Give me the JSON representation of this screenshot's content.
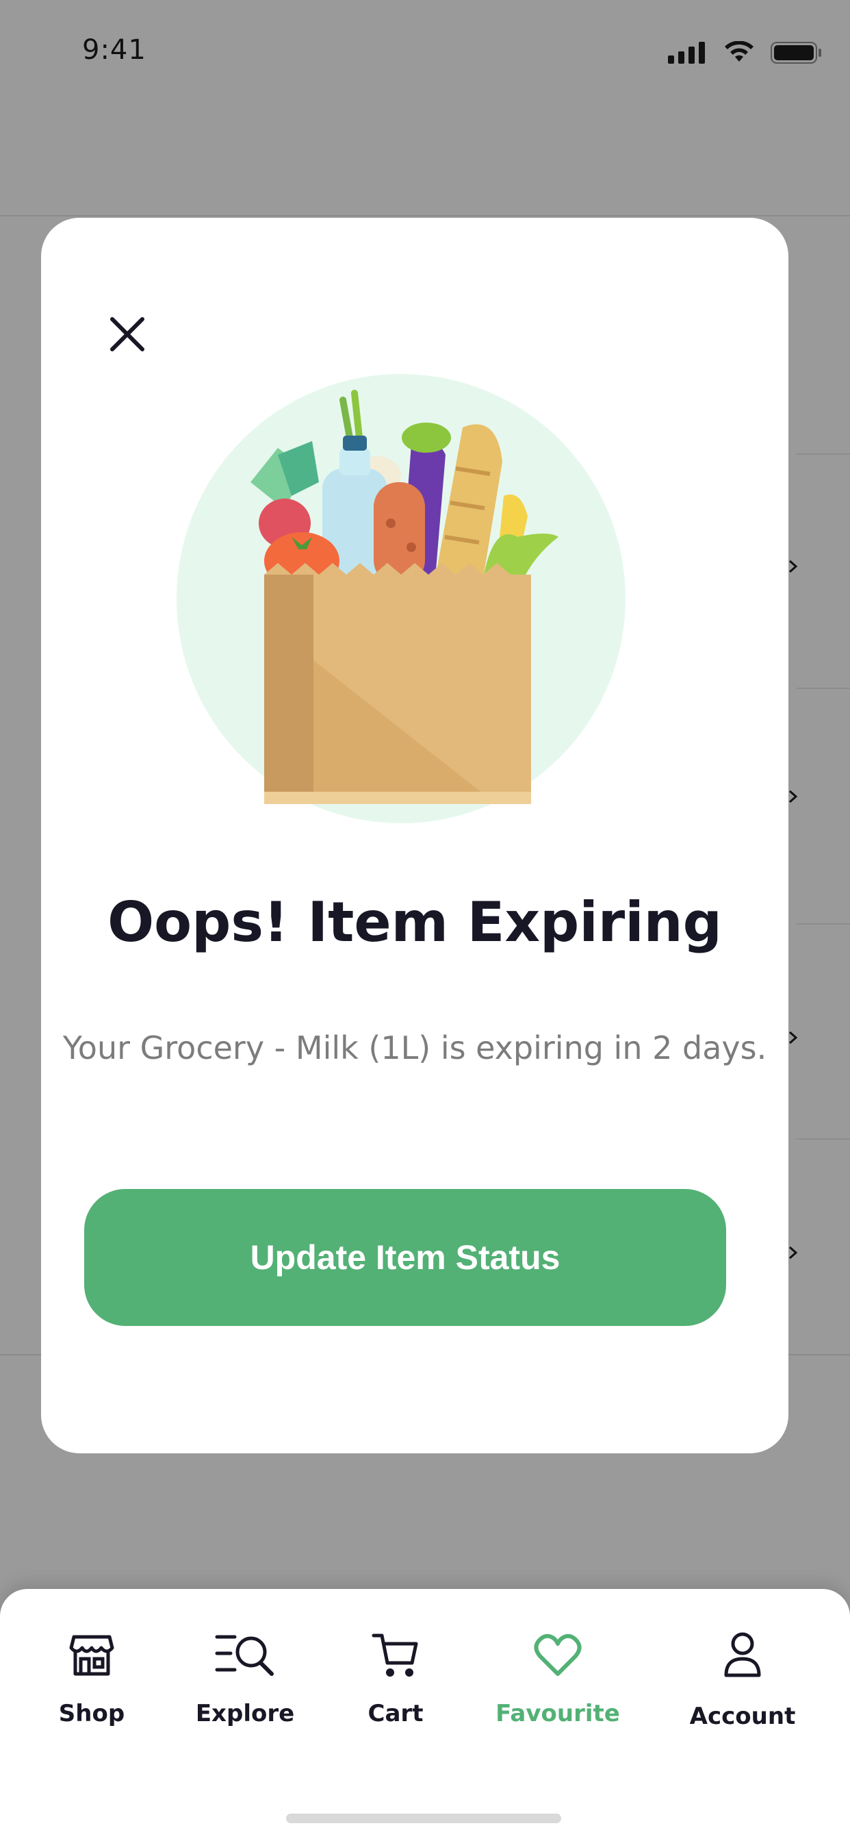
{
  "status_bar": {
    "time": "9:41"
  },
  "modal": {
    "title": "Oops! Item Expiring",
    "message": "Your Grocery - Milk (1L) is expiring in 2 days.",
    "button_label": "Update Item Status"
  },
  "tab_bar": {
    "items": [
      {
        "label": "Shop",
        "icon": "store-icon"
      },
      {
        "label": "Explore",
        "icon": "explore-icon"
      },
      {
        "label": "Cart",
        "icon": "cart-icon"
      },
      {
        "label": "Favourite",
        "icon": "heart-icon",
        "active": true
      },
      {
        "label": "Account",
        "icon": "user-icon"
      }
    ]
  },
  "colors": {
    "accent": "#53B175",
    "title": "#181725",
    "muted_text": "#7C7C7C",
    "overlay": "#9A9A9A"
  }
}
